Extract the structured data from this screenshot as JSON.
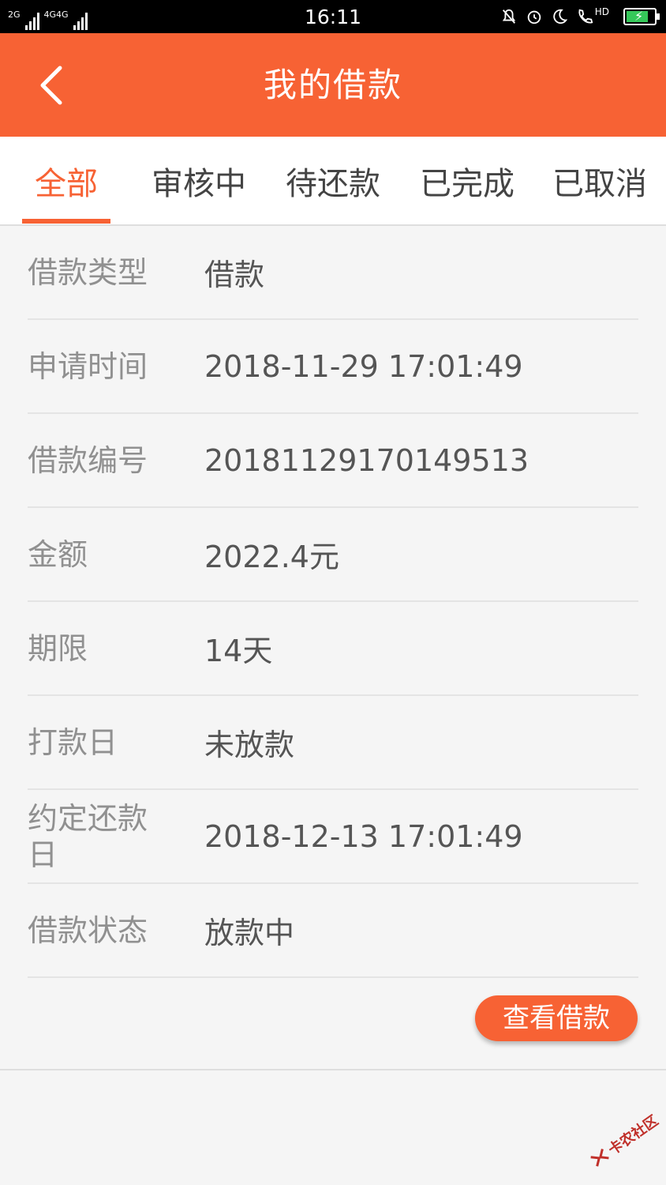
{
  "status_bar": {
    "network_1": "2G",
    "network_2": "4G4G",
    "time": "16:11",
    "hd_label": "HD",
    "icons": [
      "signal-icon",
      "mute-bell-icon",
      "alarm-icon",
      "moon-icon",
      "call-hd-icon",
      "battery-charging-icon"
    ]
  },
  "header": {
    "title": "我的借款",
    "back_icon": "chevron-left-icon",
    "color": "#f76234"
  },
  "tabs": [
    {
      "label": "全部",
      "active": true
    },
    {
      "label": "审核中",
      "active": false
    },
    {
      "label": "待还款",
      "active": false
    },
    {
      "label": "已完成",
      "active": false
    },
    {
      "label": "已取消",
      "active": false
    }
  ],
  "details": [
    {
      "label": "借款类型",
      "value": "借款"
    },
    {
      "label": "申请时间",
      "value": "2018-11-29 17:01:49"
    },
    {
      "label": "借款编号",
      "value": "20181129170149513"
    },
    {
      "label": "金额",
      "value": "2022.4元"
    },
    {
      "label": "期限",
      "value": "14天"
    },
    {
      "label": "打款日",
      "value": "未放款"
    },
    {
      "label": "约定还款日",
      "value": "2018-12-13 17:01:49"
    },
    {
      "label": "借款状态",
      "value": "放款中"
    }
  ],
  "action": {
    "view_button": "查看借款"
  },
  "watermark": {
    "text": "卡农社区"
  },
  "colors": {
    "accent": "#f76234",
    "label": "#909090",
    "value": "#555555"
  }
}
